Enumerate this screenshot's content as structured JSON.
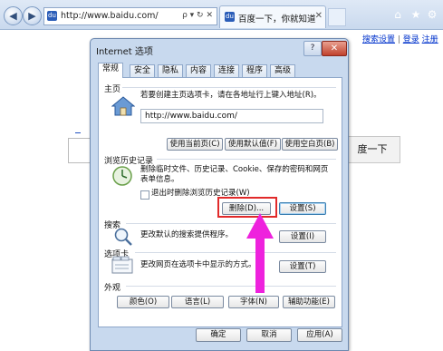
{
  "browser": {
    "address_url": "http://www.baidu.com/",
    "tab_title": "百度一下，你就知道",
    "address_glyph": "ρ ▾ ↻ ✕"
  },
  "page": {
    "top_links": [
      "搜索设置",
      "登录",
      "注册"
    ],
    "search_button": "度一下"
  },
  "dialog": {
    "title": "Internet 选项",
    "help": "?",
    "close": "✕",
    "tabs": [
      "常规",
      "安全",
      "隐私",
      "内容",
      "连接",
      "程序",
      "高级"
    ],
    "home": {
      "heading": "主页",
      "description": "若要创建主页选项卡，请在各地址行上键入地址(R)。",
      "url": "http://www.baidu.com/",
      "btn_current": "使用当前页(C)",
      "btn_default": "使用默认值(F)",
      "btn_blank": "使用空白页(B)"
    },
    "history": {
      "heading": "浏览历史记录",
      "description": "删除临时文件、历史记录、Cookie、保存的密码和网页表单信息。",
      "checkbox": "退出时删除浏览历史记录(W)",
      "btn_delete": "删除(D)...",
      "btn_settings": "设置(S)"
    },
    "search": {
      "heading": "搜索",
      "description": "更改默认的搜索提供程序。",
      "btn_settings": "设置(I)"
    },
    "tabs_section": {
      "heading": "选项卡",
      "description": "更改网页在选项卡中显示的方式。",
      "btn_settings": "设置(T)"
    },
    "appearance": {
      "heading": "外观",
      "btn_colors": "颜色(O)",
      "btn_languages": "语言(L)",
      "btn_fonts": "字体(N)",
      "btn_accessibility": "辅助功能(E)"
    },
    "footer": {
      "ok": "确定",
      "cancel": "取消",
      "apply": "应用(A)"
    }
  },
  "colors": {
    "highlight_box": "#e12a2a",
    "arrow": "#ee22dd"
  }
}
